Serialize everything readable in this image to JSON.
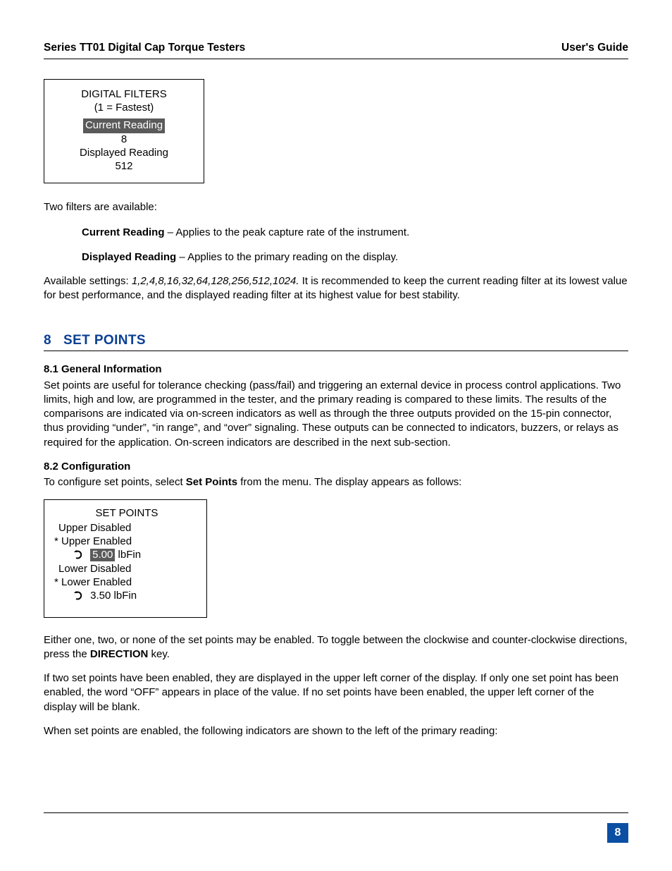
{
  "header": {
    "left": "Series TT01 Digital Cap Torque Testers",
    "right": "User's Guide"
  },
  "filters_box": {
    "title1": "DIGITAL FILTERS",
    "title2": "(1 = Fastest)",
    "current_label": "Current Reading",
    "current_value": "8",
    "displayed_label": "Displayed Reading",
    "displayed_value": "512"
  },
  "two_filters_intro": "Two filters are available:",
  "current_reading": {
    "label": "Current Reading",
    "dash": " – ",
    "desc": "Applies to the peak capture rate of the instrument."
  },
  "displayed_reading": {
    "label": "Displayed Reading",
    "dash": " – ",
    "desc": "Applies to the primary reading on the display."
  },
  "available_settings": {
    "prefix": "Available settings: ",
    "list": "1,2,4,8,16,32,64,128,256,512,1024.",
    "rest": " It is recommended to keep the current reading filter at its lowest value for best performance, and the displayed reading filter at its highest value for best stability."
  },
  "section8": {
    "num": "8",
    "title": "SET POINTS",
    "sub1_num": "8.1 General Information",
    "sub1_body": "Set points are useful for tolerance checking (pass/fail) and triggering an external device in process control applications. Two limits, high and low, are programmed in the tester, and the primary reading is compared to these limits. The results of the comparisons are indicated via on-screen indicators as well as through the three outputs provided on the 15-pin connector, thus providing “under”, “in range”, and “over” signaling. These outputs can be connected to indicators, buzzers, or relays as required for the application. On-screen indicators are described in the next sub-section.",
    "sub2_num": "8.2 Configuration",
    "sub2_intro_pre": "To configure set points, select ",
    "sub2_intro_bold": "Set Points",
    "sub2_intro_post": " from the menu. The display appears as follows:"
  },
  "setpoints_box": {
    "title": "SET POINTS",
    "upper_disabled": "Upper Disabled",
    "upper_enabled": "*  Upper Enabled",
    "upper_value": "5.00",
    "upper_unit": " lbFin",
    "lower_disabled": "Lower Disabled",
    "lower_enabled": "*  Lower Enabled",
    "lower_value": "3.50",
    "lower_unit": " lbFin"
  },
  "para_either_pre": "Either one, two, or none of the set points may be enabled. To toggle between the clockwise and counter-clockwise directions, press the ",
  "para_either_bold": "DIRECTION",
  "para_either_post": " key.",
  "para_two": "If two set points have been enabled, they are displayed in the upper left corner of the display. If only one set point has been enabled, the word “OFF” appears in place of the value. If no set points have been enabled, the upper left corner of the display will be blank.",
  "para_when": "When set points are enabled, the following indicators are shown to the left of the primary reading:",
  "page_num": "8"
}
